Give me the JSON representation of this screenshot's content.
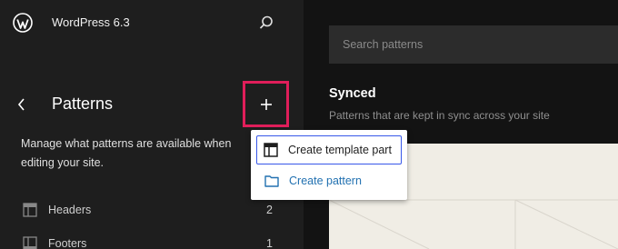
{
  "header": {
    "site_title": "WordPress 6.3"
  },
  "sidebar": {
    "title": "Patterns",
    "description": "Manage what patterns are available when editing your site.",
    "items": [
      {
        "label": "Headers",
        "count": "2",
        "icon": "header-layout-icon"
      },
      {
        "label": "Footers",
        "count": "1",
        "icon": "footer-layout-icon"
      }
    ]
  },
  "main": {
    "search_placeholder": "Search patterns",
    "section_title": "Synced",
    "section_subtitle": "Patterns that are kept in sync across your site"
  },
  "dropdown": {
    "items": [
      {
        "label": "Create template part",
        "icon": "template-part-icon"
      },
      {
        "label": "Create pattern",
        "icon": "folder-icon"
      }
    ]
  },
  "colors": {
    "highlight": "#e01e5a",
    "focus": "#3858e9",
    "link": "#2271b1"
  }
}
